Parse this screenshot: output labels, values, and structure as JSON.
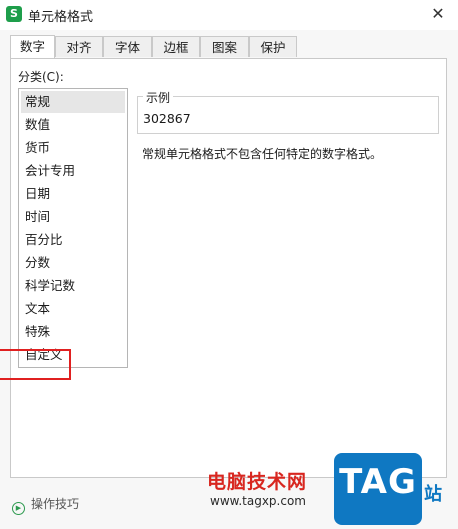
{
  "window": {
    "icon_glyph": "S",
    "title": "单元格格式",
    "close_glyph": "✕"
  },
  "tabs": [
    {
      "label": "数字"
    },
    {
      "label": "对齐"
    },
    {
      "label": "字体"
    },
    {
      "label": "边框"
    },
    {
      "label": "图案"
    },
    {
      "label": "保护"
    }
  ],
  "category": {
    "label": "分类(C):",
    "items": [
      "常规",
      "数值",
      "货币",
      "会计专用",
      "日期",
      "时间",
      "百分比",
      "分数",
      "科学记数",
      "文本",
      "特殊",
      "自定义"
    ],
    "selected": "常规"
  },
  "sample": {
    "label": "示例",
    "value": "302867"
  },
  "description": "常规单元格格式不包含任何特定的数字格式。",
  "footer": {
    "tips_label": "操作技巧",
    "tips_icon": "play-circle-icon"
  },
  "watermark": {
    "text": "电脑技术网",
    "url": "www.tagxp.com",
    "logo": "TAG",
    "suffix": "站"
  },
  "colors": {
    "accent_green": "#1e9e4b",
    "highlight_red": "#e02020",
    "watermark_blue": "#0f78c2"
  }
}
